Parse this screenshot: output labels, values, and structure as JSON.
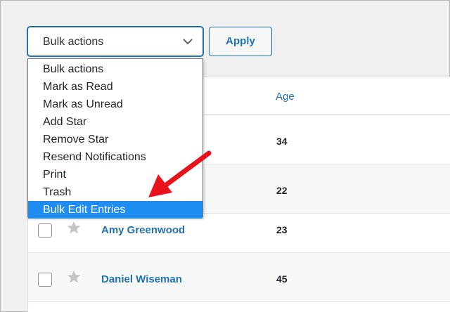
{
  "toolbar": {
    "select_value": "Bulk actions",
    "apply_label": "Apply"
  },
  "dropdown": {
    "options": [
      "Bulk actions",
      "Mark as Read",
      "Mark as Unread",
      "Add Star",
      "Remove Star",
      "Resend Notifications",
      "Print",
      "Trash",
      "Bulk Edit Entries"
    ],
    "selected_option": "Bulk Edit Entries"
  },
  "table": {
    "header": {
      "age": "Age"
    },
    "rows": [
      {
        "name": "",
        "age": "34"
      },
      {
        "name": "",
        "age": "22"
      },
      {
        "name": "Amy Greenwood",
        "age": "23"
      },
      {
        "name": "Daniel Wiseman",
        "age": "45"
      }
    ]
  },
  "colors": {
    "link_blue": "#2271b1",
    "highlight_blue": "#1e8cf0",
    "arrow_red": "#e8121a"
  },
  "icons": [
    "chevron-down-icon",
    "star-icon",
    "red-arrow-icon"
  ]
}
